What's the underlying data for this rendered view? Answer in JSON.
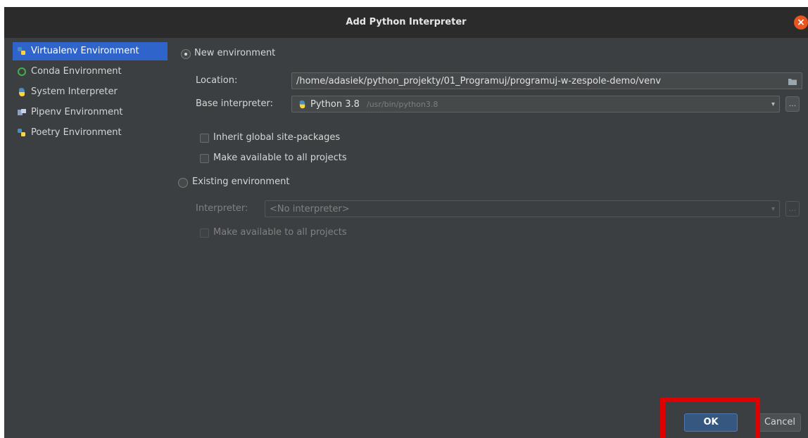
{
  "window": {
    "title": "Add Python Interpreter"
  },
  "sidebar": {
    "items": [
      {
        "label": "Virtualenv Environment",
        "icon": "python-virtualenv-icon",
        "selected": true
      },
      {
        "label": "Conda Environment",
        "icon": "conda-ring-icon",
        "selected": false
      },
      {
        "label": "System Interpreter",
        "icon": "python-icon",
        "selected": false
      },
      {
        "label": "Pipenv Environment",
        "icon": "pipenv-icon",
        "selected": false
      },
      {
        "label": "Poetry Environment",
        "icon": "poetry-icon",
        "selected": false
      }
    ]
  },
  "main": {
    "new_env": {
      "radio_label": "New environment",
      "checked": true,
      "location_label": "Location:",
      "location_value": "/home/adasiek/python_projekty/01_Programuj/programuj-w-zespole-demo/venv",
      "base_label": "Base interpreter:",
      "base_name": "Python 3.8",
      "base_path": "/usr/bin/python3.8",
      "inherit_label": "Inherit global site-packages",
      "make_available_label": "Make available to all projects"
    },
    "existing_env": {
      "radio_label": "Existing environment",
      "checked": false,
      "interpreter_label": "Interpreter:",
      "interpreter_placeholder": "<No interpreter>",
      "make_available_label": "Make available to all projects"
    },
    "browse_label": "...",
    "dropdown_glyph": "▾"
  },
  "footer": {
    "ok_label": "OK",
    "cancel_label": "Cancel"
  },
  "colors": {
    "accent": "#2f65ca",
    "highlight": "#e00000",
    "ok": "#365880",
    "background": "#3c3f41"
  }
}
